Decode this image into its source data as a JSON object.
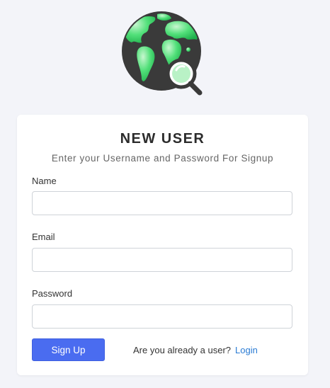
{
  "logo": {
    "icon": "globe-search-icon"
  },
  "form": {
    "title": "NEW USER",
    "subtitle": "Enter your Username and Password For Signup",
    "fields": [
      {
        "label": "Name",
        "value": "",
        "placeholder": ""
      },
      {
        "label": "Email",
        "value": "",
        "placeholder": ""
      },
      {
        "label": "Password",
        "value": "",
        "placeholder": ""
      }
    ],
    "submit_label": "Sign Up",
    "already_text": "Are you already a user?",
    "login_link": "Login"
  },
  "colors": {
    "background": "#f3f4f9",
    "button": "#4a6cf0",
    "link": "#2a7bd4",
    "globe_green": "#3ed66a",
    "globe_dark": "#3a3a3a"
  }
}
